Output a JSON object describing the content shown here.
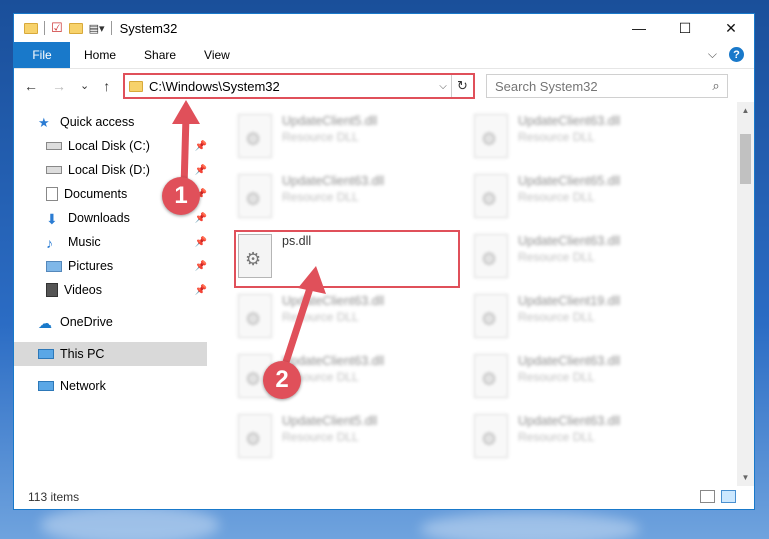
{
  "window": {
    "title": "System32",
    "controls": {
      "minimize": "—",
      "maximize": "☐",
      "close": "✕"
    }
  },
  "ribbon": {
    "file_tab": "File",
    "tabs": [
      "Home",
      "Share",
      "View"
    ],
    "expand": "⌵",
    "help": "?"
  },
  "address": {
    "path": "C:\\Windows\\System32",
    "dropdown": "⌵",
    "refresh": "↻"
  },
  "search": {
    "placeholder": "Search System32",
    "icon": "search-icon"
  },
  "nav_buttons": {
    "back": "←",
    "forward": "→",
    "recent": "⌄",
    "up": "↑"
  },
  "sidebar": {
    "items": [
      {
        "label": "Quick access",
        "icon": "star-icon",
        "pinned": false
      },
      {
        "label": "Local Disk (C:)",
        "icon": "drive-icon",
        "pinned": true
      },
      {
        "label": "Local Disk (D:)",
        "icon": "drive-icon",
        "pinned": true
      },
      {
        "label": "Documents",
        "icon": "documents-icon",
        "pinned": true
      },
      {
        "label": "Downloads",
        "icon": "downloads-icon",
        "pinned": true
      },
      {
        "label": "Music",
        "icon": "music-icon",
        "pinned": true
      },
      {
        "label": "Pictures",
        "icon": "pictures-icon",
        "pinned": true
      },
      {
        "label": "Videos",
        "icon": "videos-icon",
        "pinned": true
      },
      {
        "label": "OneDrive",
        "icon": "cloud-icon",
        "pinned": false
      },
      {
        "label": "This PC",
        "icon": "computer-icon",
        "pinned": false,
        "selected": true
      },
      {
        "label": "Network",
        "icon": "network-icon",
        "pinned": false
      }
    ],
    "pin_glyph": "📌"
  },
  "files": {
    "items": [
      {
        "name": "UpdateClient5.dll",
        "type": "Resource DLL"
      },
      {
        "name": "UpdateClient63.dll",
        "type": "Resource DLL"
      },
      {
        "name": "UpdateClient63.dll",
        "type": "Resource DLL"
      },
      {
        "name": "UpdateClient65.dll",
        "type": "Resource DLL"
      },
      {
        "name": "ps.dll",
        "type": ""
      },
      {
        "name": "UpdateClient63.dll",
        "type": "Resource DLL"
      },
      {
        "name": "UpdateClient63.dll",
        "type": "Resource DLL"
      },
      {
        "name": "UpdateClient19.dll",
        "type": "Resource DLL"
      },
      {
        "name": "UpdateClient63.dll",
        "type": "Resource DLL"
      },
      {
        "name": "UpdateClient63.dll",
        "type": "Resource DLL"
      },
      {
        "name": "UpdateClient5.dll",
        "type": "Resource DLL"
      },
      {
        "name": "UpdateClient63.dll",
        "type": "Resource DLL"
      }
    ]
  },
  "status": {
    "item_count": "113 items"
  },
  "callouts": {
    "one": "1",
    "two": "2"
  },
  "colors": {
    "accent": "#1979ca",
    "callout": "#e0505a"
  }
}
